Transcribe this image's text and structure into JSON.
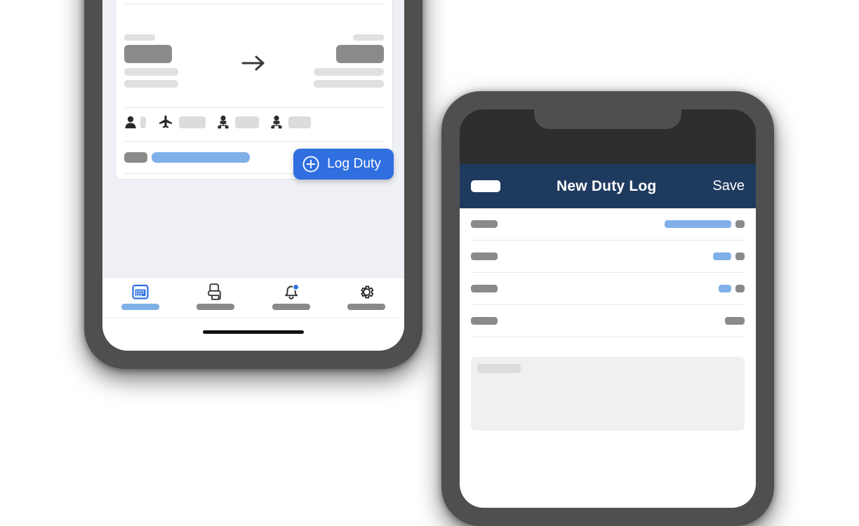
{
  "scene": {
    "description": "Two smartphone mockups showing a pilot duty-logging app",
    "accent_blue": "#2f6fe0",
    "light_blue": "#80b0e8",
    "navy": "#1e3a5f",
    "frame_gray": "#4f4f4f",
    "page_bg": "#eff0f5"
  },
  "left_phone": {
    "name": "duty-list-screen",
    "card": {
      "title_placeholder": "",
      "route": {
        "origin_label_placeholder": "",
        "origin_code_placeholder": "",
        "destination_label_placeholder": "",
        "destination_code_placeholder": "",
        "arrow_icon": "arrow-right-icon"
      },
      "crew_items": [
        {
          "icon": "person-icon",
          "chip_width": 8
        },
        {
          "icon": "airplane-icon",
          "chip_width": 38
        },
        {
          "icon": "crew-member-icon",
          "chip_width": 34
        },
        {
          "icon": "crew-member-icon",
          "chip_width": 32
        }
      ],
      "status": {
        "tag_placeholder": "",
        "progress_placeholder": ""
      }
    },
    "log_duty_button": {
      "label": "Log Duty",
      "icon": "plus-circle-icon"
    },
    "tabs": [
      {
        "icon": "calendar-icon",
        "active": true,
        "badge": false
      },
      {
        "icon": "documents-icon",
        "active": false,
        "badge": false
      },
      {
        "icon": "bell-icon",
        "active": false,
        "badge": true
      },
      {
        "icon": "gear-icon",
        "active": false,
        "badge": false
      }
    ],
    "home_indicator": true
  },
  "right_phone": {
    "name": "new-duty-log-screen",
    "nav": {
      "back_placeholder": "",
      "title": "New Duty Log",
      "save_label": "Save"
    },
    "form_rows": [
      {
        "label_placeholder": "",
        "value_bar_width": 95,
        "has_chip": true
      },
      {
        "label_placeholder": "",
        "value_bar_width": 26,
        "has_chip": true
      },
      {
        "label_placeholder": "",
        "value_bar_width": 18,
        "has_chip": true
      },
      {
        "label_placeholder": "",
        "value_bar_width": 0,
        "has_chip": true,
        "chip_wide": true
      }
    ],
    "notes_field": {
      "placeholder_block": ""
    }
  }
}
